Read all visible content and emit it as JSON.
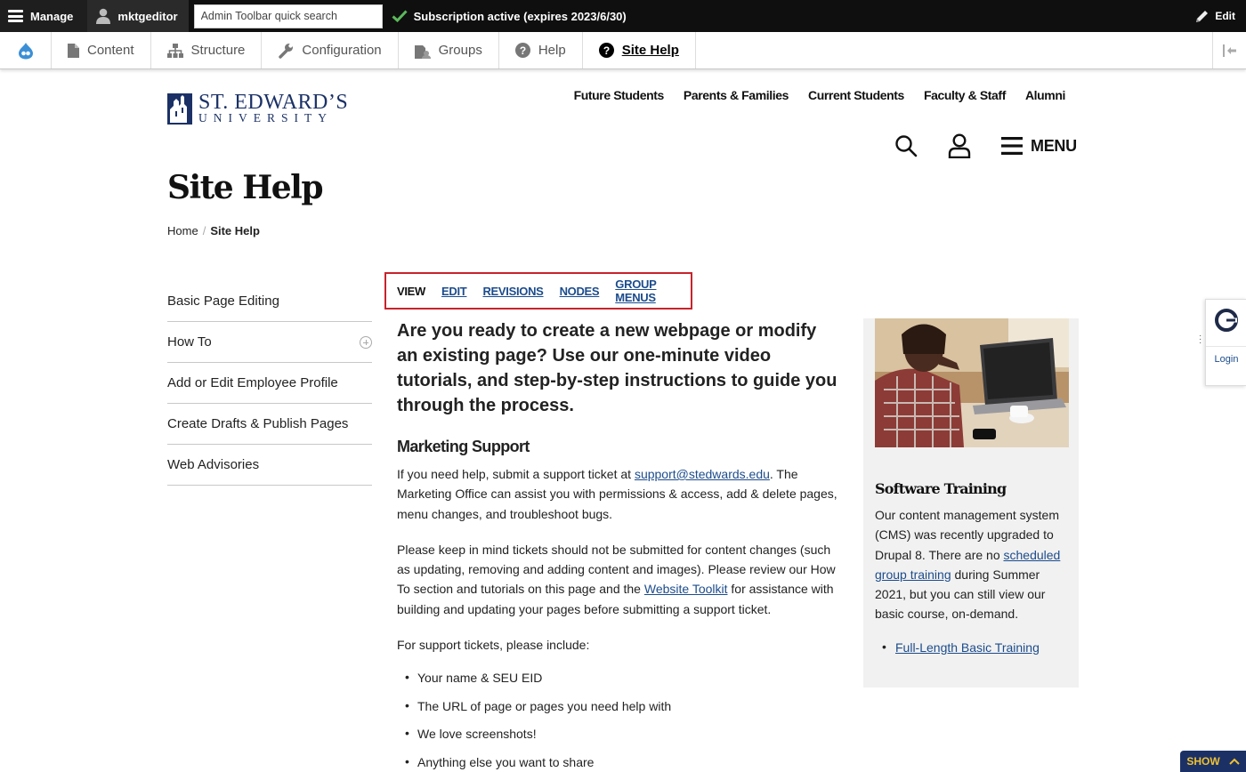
{
  "admin_toolbar": {
    "manage_label": "Manage",
    "user_label": "mktgeditor",
    "search_placeholder": "Admin Toolbar quick search",
    "subscription_status": "Subscription active (expires 2023/6/30)",
    "edit_label": "Edit"
  },
  "tray": {
    "items": [
      {
        "label": "Content",
        "icon": "document-icon"
      },
      {
        "label": "Structure",
        "icon": "sitemap-icon"
      },
      {
        "label": "Configuration",
        "icon": "wrench-icon"
      },
      {
        "label": "Groups",
        "icon": "groups-icon"
      },
      {
        "label": "Help",
        "icon": "help-icon"
      },
      {
        "label": "Site Help",
        "icon": "help-icon",
        "active": true
      }
    ]
  },
  "site": {
    "logo_line1": "ST. EDWARD’S",
    "logo_line2": "UNIVERSITY",
    "top_nav": [
      "Future Students",
      "Parents & Families",
      "Current Students",
      "Faculty & Staff",
      "Alumni"
    ],
    "menu_label": "MENU"
  },
  "page": {
    "title": "Site Help",
    "breadcrumb": {
      "home": "Home",
      "sep": "/",
      "current": "Site Help"
    }
  },
  "sidebar": {
    "items": [
      {
        "label": "Basic Page Editing",
        "expandable": false
      },
      {
        "label": "How To",
        "expandable": true
      },
      {
        "label": "Add or Edit Employee Profile",
        "expandable": false
      },
      {
        "label": "Create Drafts & Publish Pages",
        "expandable": false
      },
      {
        "label": "Web Advisories",
        "expandable": false
      }
    ]
  },
  "tabs": {
    "items": [
      {
        "label": "VIEW",
        "current": true
      },
      {
        "label": "EDIT"
      },
      {
        "label": "REVISIONS"
      },
      {
        "label": "NODES"
      },
      {
        "label": "GROUP MENUS"
      }
    ]
  },
  "main": {
    "lead": "Are you ready to create a new webpage or modify an existing page? Use our one-minute video tutorials, and step-by-step instructions to guide you through the process.",
    "section_heading": "Marketing Support",
    "p1_before": "If you need help, submit a support ticket at ",
    "p1_link": "support@stedwards.edu",
    "p1_after": ". The Marketing Office can assist you with permissions & access, add & delete pages, menu changes, and troubleshoot bugs.",
    "p2_before": "Please keep in mind tickets should not be submitted for content changes (such as updating, removing and adding content and images). Please review our How To section and tutorials on this page and the ",
    "p2_link": "Website Toolkit",
    "p2_after": " for assistance with building and updating your pages before submitting a support ticket.",
    "p3": "For support tickets, please include:",
    "list": [
      "Your name & SEU EID",
      "The URL of page or pages you need help with",
      "We love screenshots!",
      "Anything else you want to share"
    ]
  },
  "aside": {
    "heading": "Software Training",
    "text_before": "Our content management system (CMS) was recently upgraded to Drupal 8. There are no ",
    "text_link": "scheduled group training",
    "text_after": " during Summer 2021, but you can still view our basic course, on-demand.",
    "link_item": "Full-Length Basic Training"
  },
  "widget": {
    "login_label": "Login"
  },
  "show_button": {
    "label": "SHOW"
  },
  "colors": {
    "brand_navy": "#1b3166",
    "link_blue": "#1c4c8c",
    "highlight_red": "#c8232c",
    "check_green": "#5cb85c",
    "show_gold": "#f0c130"
  }
}
